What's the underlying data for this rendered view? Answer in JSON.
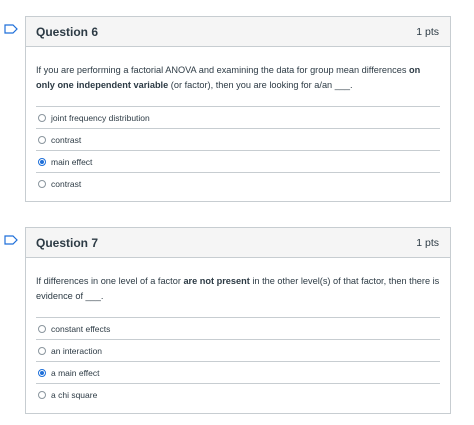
{
  "questions": [
    {
      "title": "Question 6",
      "points": "1 pts",
      "text_before": "If you are performing a factorial ANOVA and examining the data for group mean differences ",
      "text_bold": "on only one independent variable",
      "text_after": " (or factor), then you are looking for a/an ___.",
      "answers": [
        {
          "label": "joint frequency distribution",
          "selected": false
        },
        {
          "label": "contrast",
          "selected": false
        },
        {
          "label": "main effect",
          "selected": true
        },
        {
          "label": "contrast",
          "selected": false
        }
      ]
    },
    {
      "title": "Question 7",
      "points": "1 pts",
      "text_before": "If differences in one level of a factor ",
      "text_bold": "are not present",
      "text_after": " in the other level(s) of that factor, then there is evidence of ___.",
      "answers": [
        {
          "label": "constant effects",
          "selected": false
        },
        {
          "label": "an interaction",
          "selected": false
        },
        {
          "label": "a main effect",
          "selected": true
        },
        {
          "label": "a chi square",
          "selected": false
        }
      ]
    }
  ],
  "colors": {
    "accent": "#1e6fd9",
    "border": "#c7cdd1",
    "header_bg": "#f5f5f5",
    "text": "#2d3b45"
  }
}
